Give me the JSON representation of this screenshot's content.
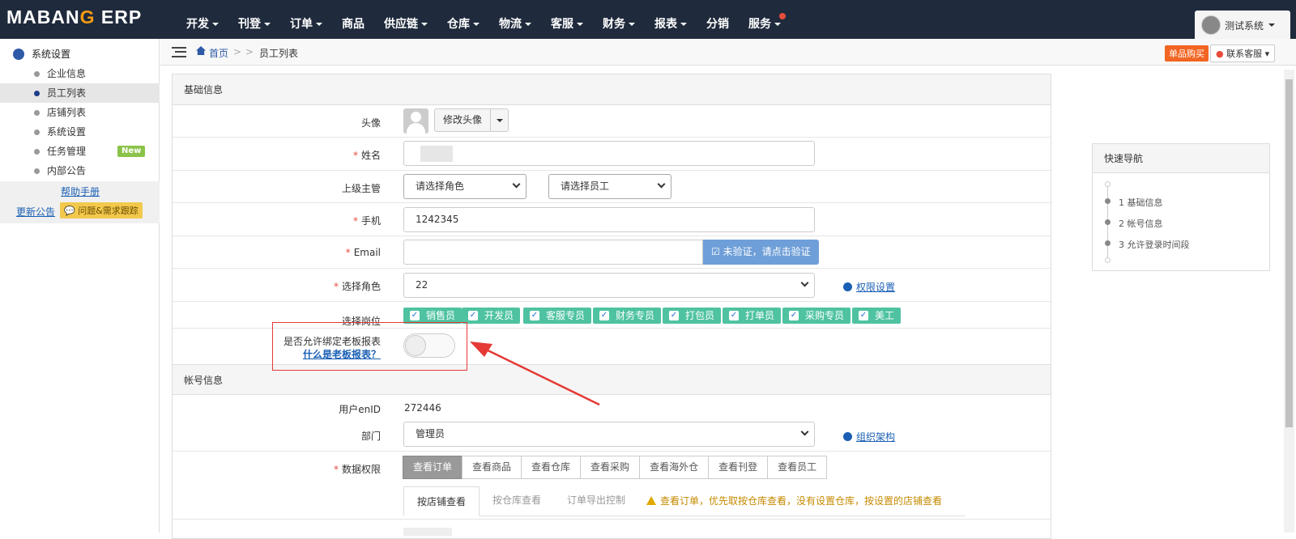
{
  "app": {
    "logo_part1": "MABAN",
    "logo_g": "G",
    "logo_part2": " ERP"
  },
  "nav": [
    {
      "label": "开发",
      "caret": true
    },
    {
      "label": "刊登",
      "caret": true
    },
    {
      "label": "订单",
      "caret": true
    },
    {
      "label": "商品",
      "caret": false
    },
    {
      "label": "供应链",
      "caret": true
    },
    {
      "label": "仓库",
      "caret": true
    },
    {
      "label": "物流",
      "caret": true
    },
    {
      "label": "客服",
      "caret": true
    },
    {
      "label": "财务",
      "caret": true
    },
    {
      "label": "报表",
      "caret": true
    },
    {
      "label": "分销",
      "caret": false
    },
    {
      "label": "服务",
      "caret": true
    }
  ],
  "user": {
    "name": "测试系统"
  },
  "sidebar": {
    "title": "系统设置",
    "items": [
      {
        "label": "企业信息"
      },
      {
        "label": "员工列表",
        "active": true
      },
      {
        "label": "店铺列表"
      },
      {
        "label": "系统设置"
      },
      {
        "label": "任务管理",
        "badge": "New"
      },
      {
        "label": "内部公告"
      }
    ],
    "help": "帮助手册",
    "update": "更新公告",
    "feedback": "问题&需求跟踪"
  },
  "breadcrumb": {
    "home": "首页",
    "sep": ">",
    "sep2": ">",
    "current": "员工列表"
  },
  "topright": {
    "buy": "单品购买",
    "contact": "联系客服"
  },
  "form": {
    "basic_title": "基础信息",
    "avatar_label": "头像",
    "avatar_btn": "修改头像",
    "name_label": "姓名",
    "manager_label": "上级主管",
    "role_placeholder": "请选择角色",
    "staff_placeholder": "请选择员工",
    "phone_label": "手机",
    "phone_value": "1242345",
    "email_label": "Email",
    "email_verify": "未验证，请点击验证",
    "role_label": "选择角色",
    "role_value": "22",
    "perm_link": "权限设置",
    "post_label": "选择岗位",
    "posts": [
      "销售员",
      "开发员",
      "客服专员",
      "财务专员",
      "打包员",
      "打单员",
      "采购专员",
      "美工"
    ],
    "boss_label": "是否允许绑定老板报表",
    "boss_link": "什么是老板报表？",
    "account_title": "帐号信息",
    "userid_label": "用户enID",
    "userid_value": "272446",
    "dept_label": "部门",
    "dept_value": "管理员",
    "org_link": "组织架构",
    "data_label": "数据权限",
    "data_buttons": [
      "查看订单",
      "查看商品",
      "查看仓库",
      "查看采购",
      "查看海外仓",
      "查看刊登",
      "查看员工"
    ],
    "tabs": [
      "按店铺查看",
      "按仓库查看",
      "订单导出控制"
    ],
    "warn": "查看订单，优先取按仓库查看，没有设置仓库，按设置的店铺查看"
  },
  "quicknav": {
    "title": "快速导航",
    "items": [
      "1 基础信息",
      "2 帐号信息",
      "3 允许登录时间段"
    ]
  },
  "colors": {
    "topbar": "#1f2a3c",
    "chip": "#4fc3a1",
    "annotation": "#e53935",
    "buy": "#f26522"
  }
}
